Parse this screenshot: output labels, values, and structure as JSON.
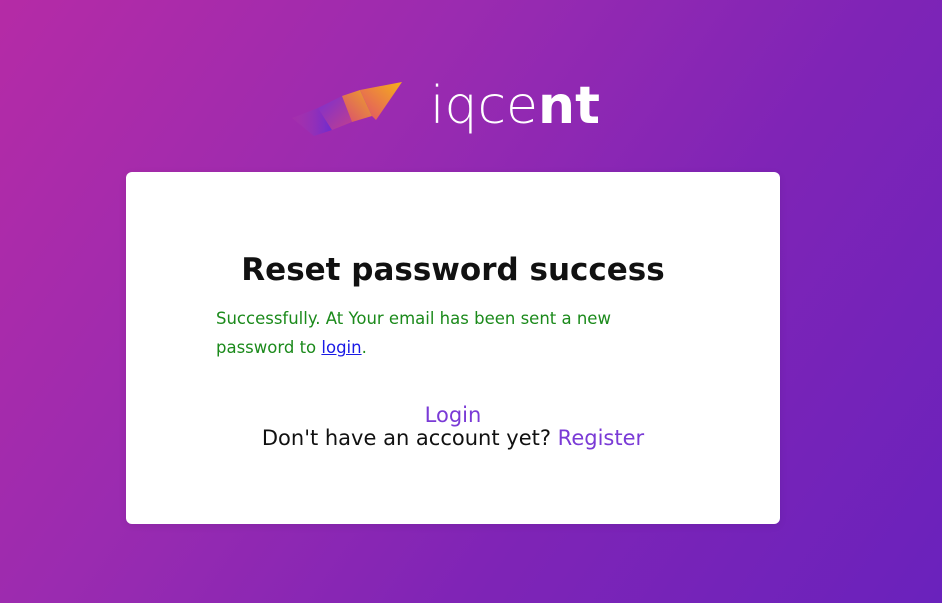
{
  "brand": {
    "name_light": "iqce",
    "name_bold": "nt",
    "colors": {
      "background_start": "#b52ba6",
      "background_end": "#6a22bc",
      "logo_mark_orange": "#f4a21d",
      "logo_mark_purple": "#6d2bd0"
    }
  },
  "card": {
    "title": "Reset password success",
    "message": {
      "text_before": "Successfully. At Your email has been sent a new password to ",
      "link_text": "login",
      "text_after": "."
    },
    "login_link": "Login",
    "register": {
      "prompt": "Don't have an account yet? ",
      "link_text": "Register"
    }
  },
  "colors": {
    "success_text": "#1b8a1b",
    "inline_link": "#1a1ae6",
    "accent_link": "#7a3ad6",
    "title_text": "#111111"
  }
}
